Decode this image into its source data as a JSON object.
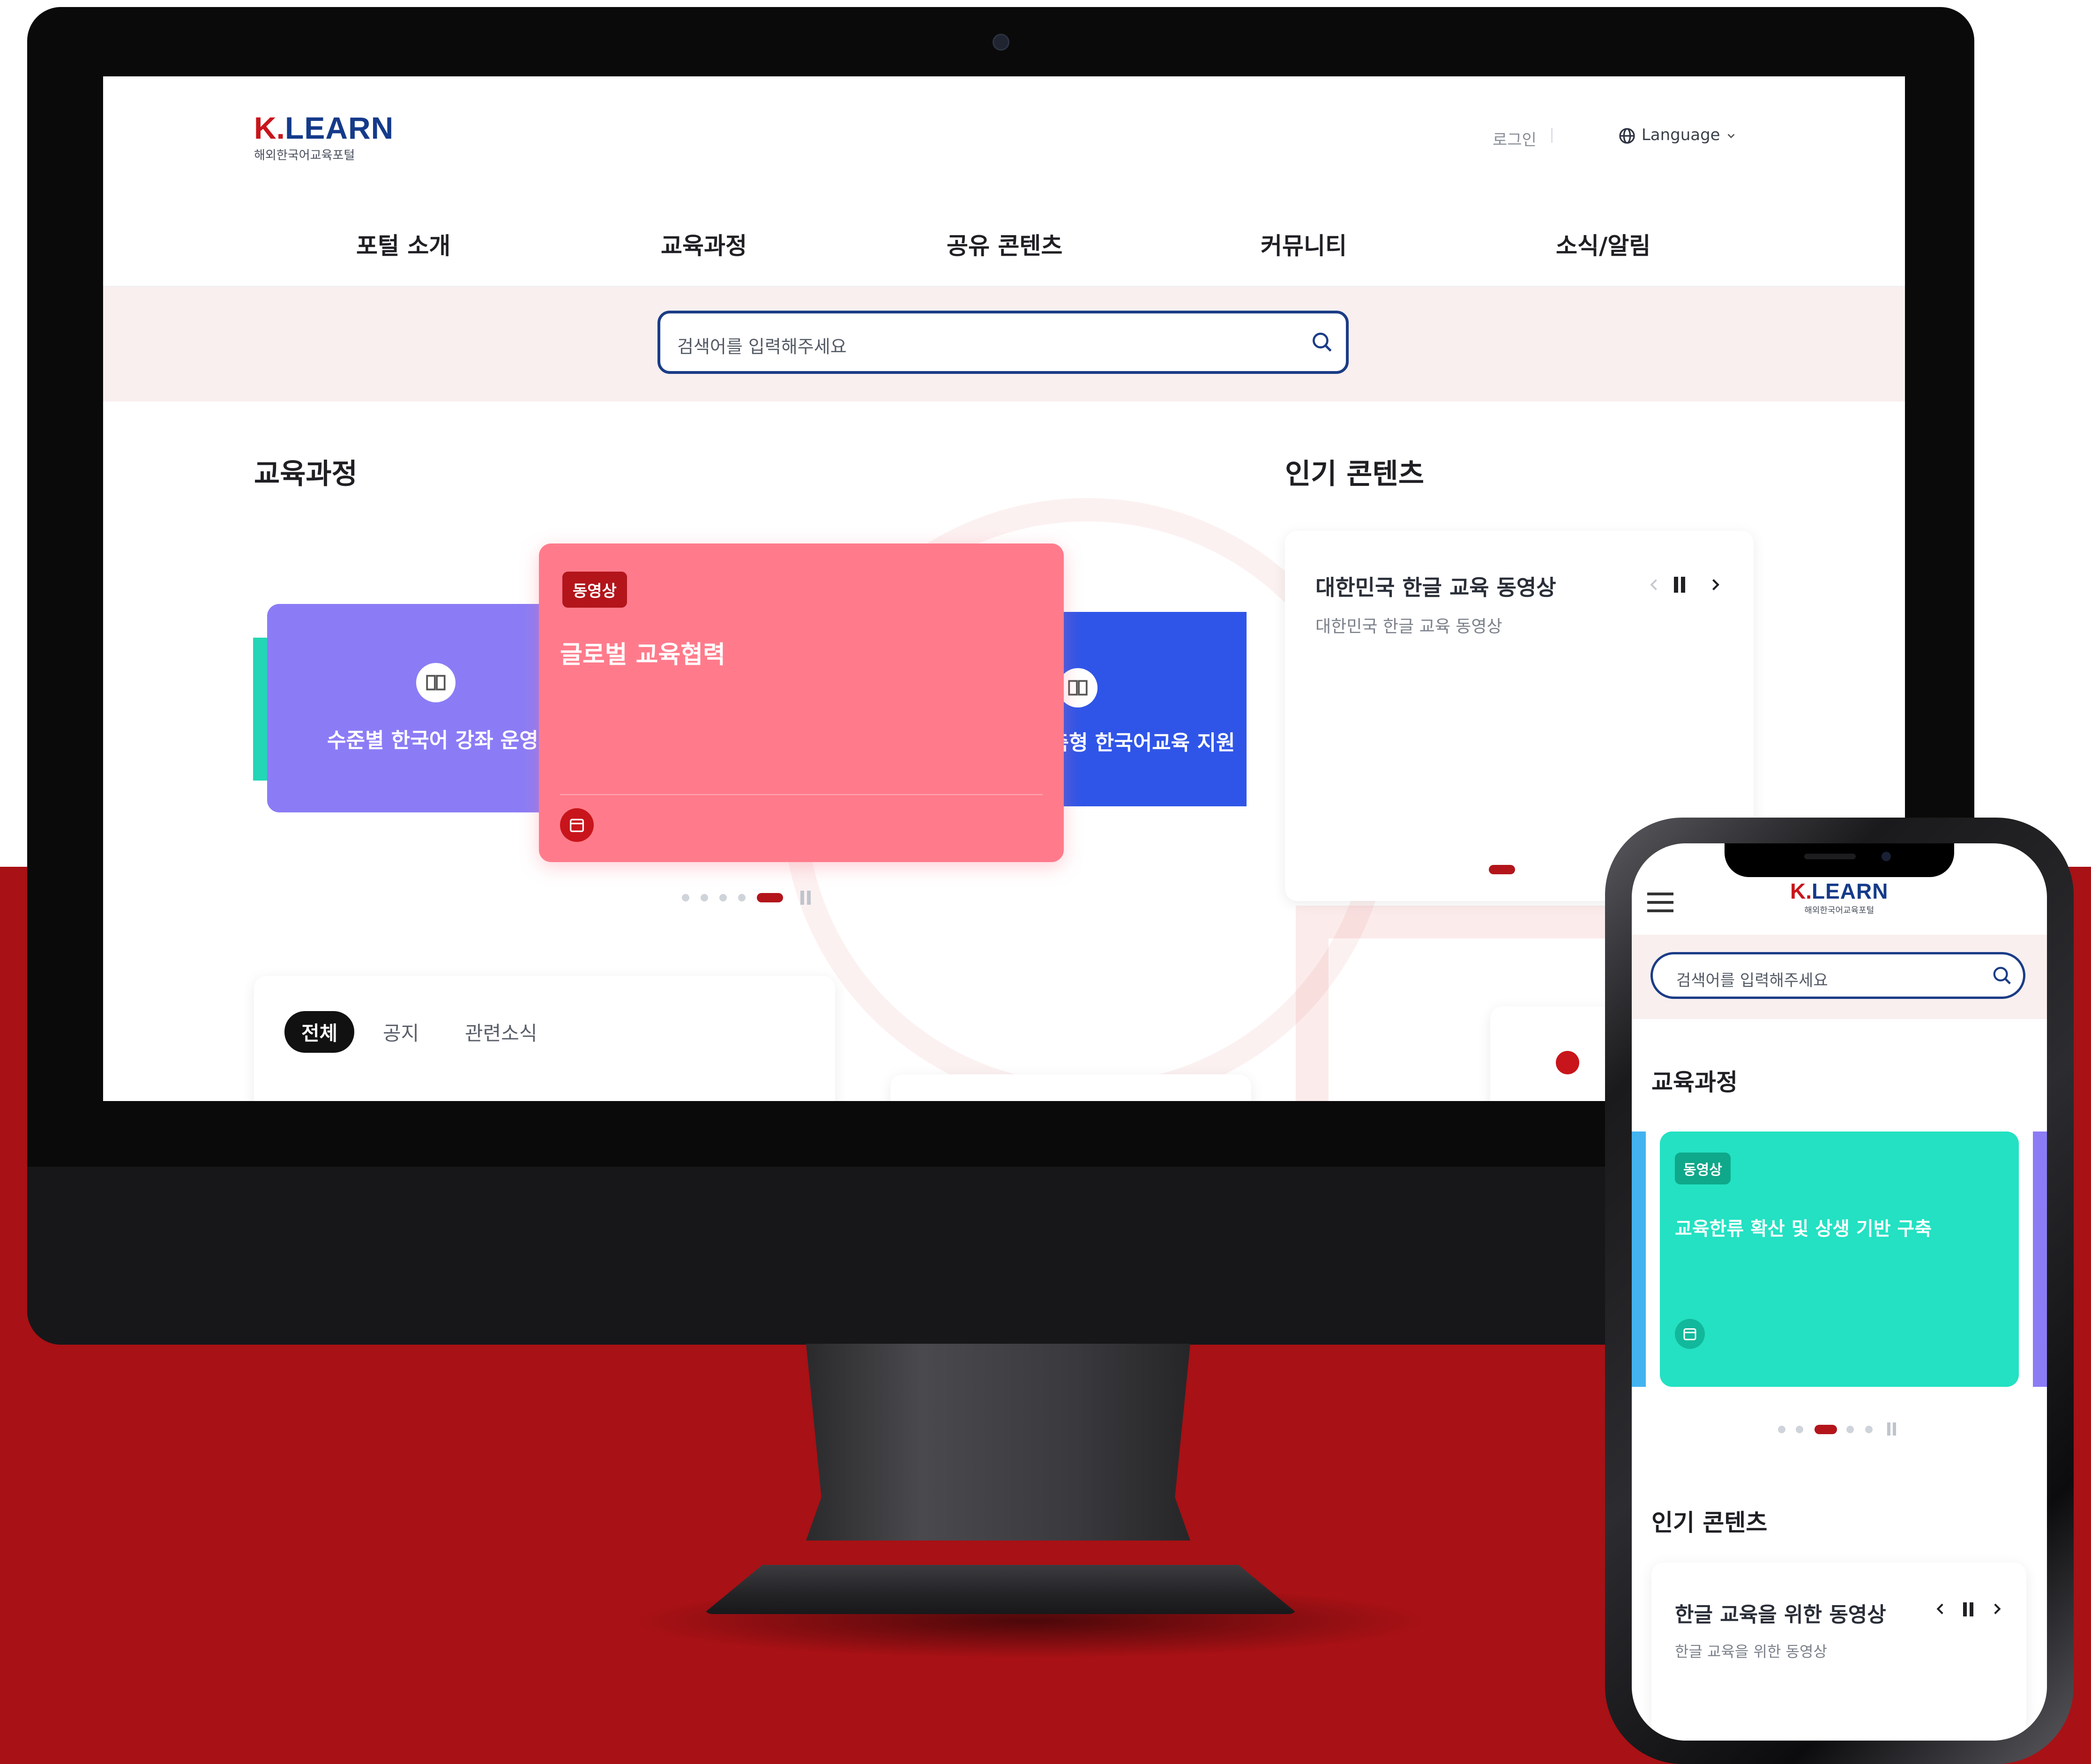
{
  "colors": {
    "brand_red": "#c8151b",
    "brand_navy": "#143a8a",
    "background_red": "#a81115",
    "card_pink": "#ff7b8b",
    "card_purple": "#8b7cf6",
    "card_blue": "#2f55e8",
    "card_teal": "#23e1c2"
  },
  "desktop": {
    "logo": {
      "mark": "K.",
      "name": "LEARN",
      "subtitle": "해외한국어교육포털"
    },
    "header": {
      "login": "로그인",
      "language": "Language"
    },
    "nav": [
      "포털 소개",
      "교육과정",
      "공유 콘텐츠",
      "커뮤니티",
      "소식/알림"
    ],
    "search": {
      "placeholder": "검색어를 입력해주세요"
    },
    "courses": {
      "title": "교육과정",
      "cards": [
        {
          "label": "수준별 한국어 강좌 운영",
          "icon": "book-icon"
        },
        {
          "badge": "동영상",
          "label": "글로벌 교육협력",
          "icon": "calendar-icon"
        },
        {
          "label": "맞춤형 한국어교육 지원",
          "icon": "book-icon"
        }
      ],
      "pagination": {
        "total": 5,
        "active_index": 4
      }
    },
    "popular": {
      "title": "인기 콘텐츠",
      "card_title": "대한민국 한글 교육 동영상",
      "card_subtitle": "대한민국 한글 교육 동영상"
    },
    "news_tabs": [
      "전체",
      "공지",
      "관련소식"
    ]
  },
  "mobile": {
    "logo": {
      "mark": "K.",
      "name": "LEARN",
      "subtitle": "해외한국어교육포털"
    },
    "search": {
      "placeholder": "검색어를 입력해주세요"
    },
    "courses": {
      "title": "교육과정",
      "card": {
        "badge": "동영상",
        "label": "교육한류 확산 및 상생 기반 구축",
        "icon": "calendar-icon"
      },
      "pagination": {
        "total": 5,
        "active_index": 2
      }
    },
    "popular": {
      "title": "인기 콘텐츠",
      "card_title": "한글 교육을 위한 동영상",
      "card_subtitle": "한글 교육을 위한 동영상"
    }
  }
}
